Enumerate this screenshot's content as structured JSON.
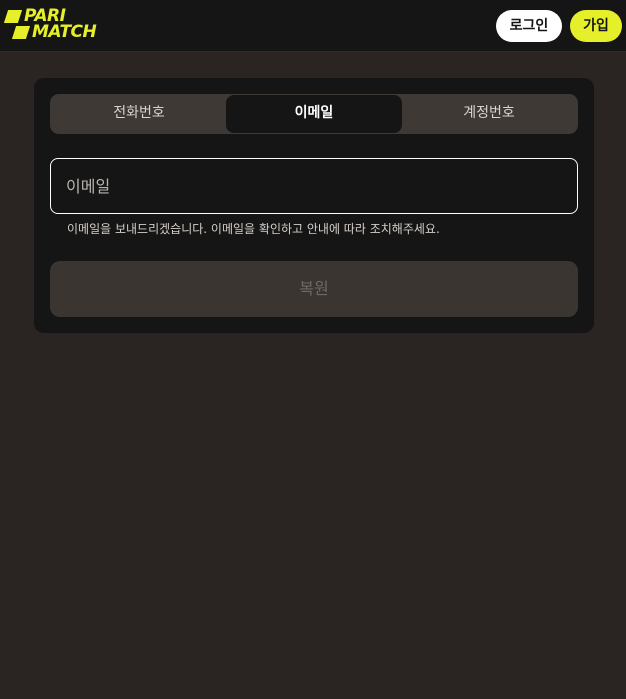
{
  "header": {
    "logo": {
      "line1": "PARI",
      "line2": "MATCH",
      "color": "#e5f02a"
    },
    "login_label": "로그인",
    "join_label": "가입"
  },
  "tabs": [
    {
      "label": "전화번호",
      "active": false
    },
    {
      "label": "이메일",
      "active": true
    },
    {
      "label": "계정번호",
      "active": false
    }
  ],
  "email": {
    "placeholder": "이메일",
    "value": ""
  },
  "hint": "이메일을 보내드리겠습니다. 이메일을 확인하고 안내에 따라 조치해주세요.",
  "restore_label": "복원",
  "colors": {
    "accent": "#e5f02a",
    "background": "#2a2522",
    "card": "#151515",
    "tab_track": "#3e3934"
  }
}
